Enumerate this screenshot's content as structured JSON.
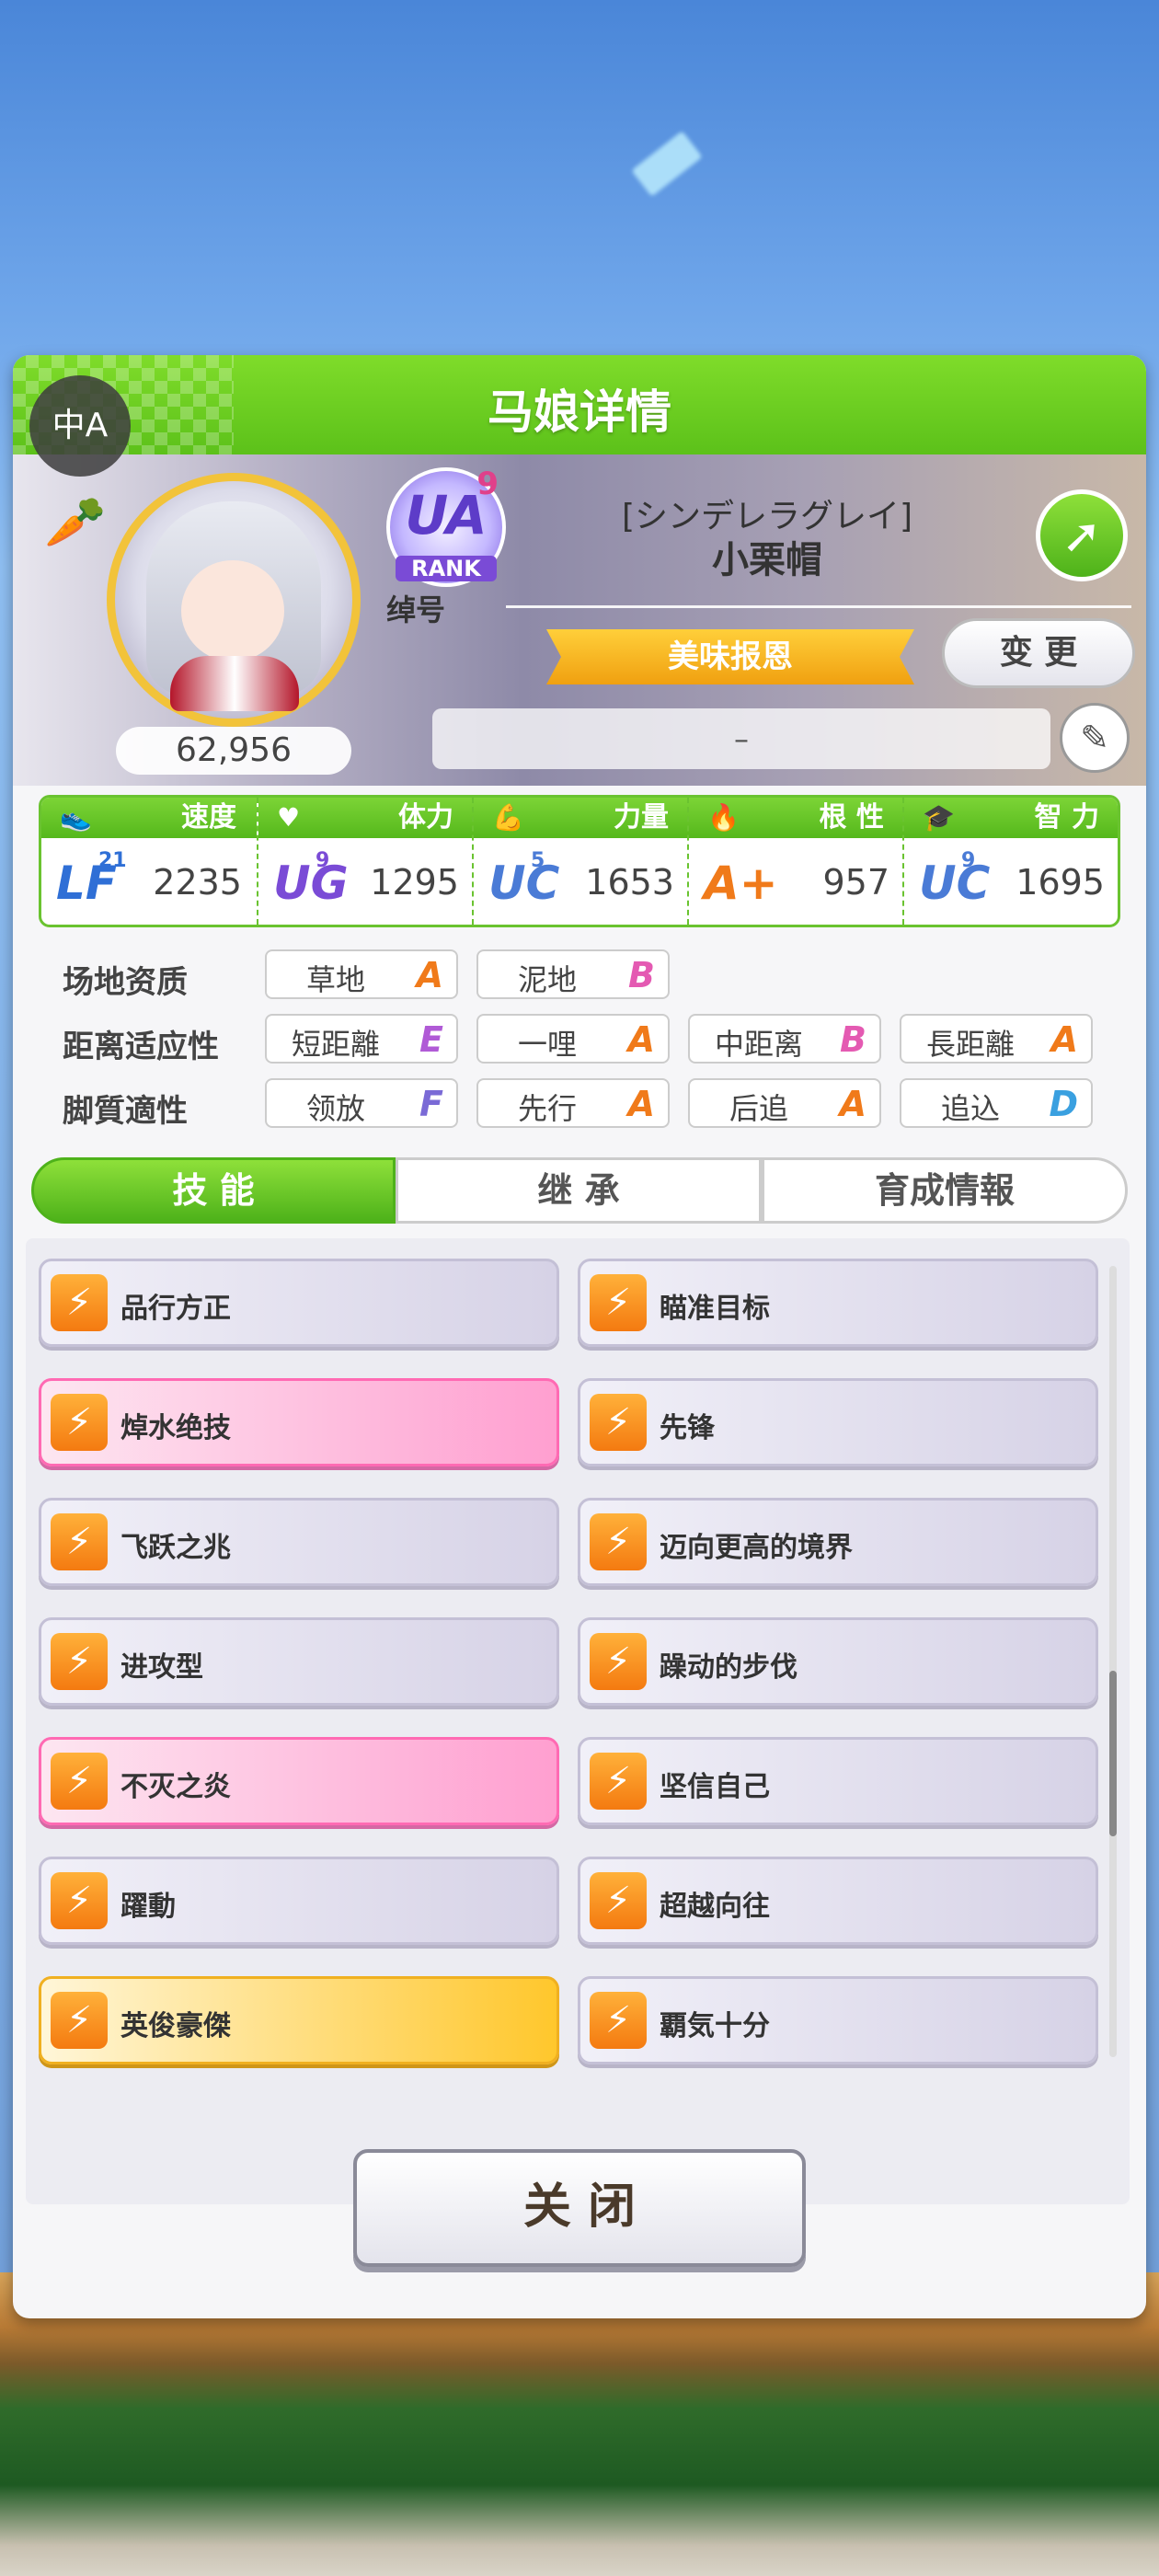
{
  "header": {
    "title": "马娘详情",
    "translate_icon": "中A"
  },
  "profile": {
    "score": "62,956",
    "rank_badge": {
      "letters": "UA",
      "number": "9",
      "label": "RANK"
    },
    "title_caption": "绰号",
    "epithet": "[シンデレラグレイ]",
    "name": "小栗帽",
    "title_ribbon": "美味报恩",
    "change_label": "变 更",
    "comment": "–"
  },
  "stats": [
    {
      "label": "速度",
      "icon": "shoe-icon",
      "grade": "LF",
      "grade_sub": "21",
      "value": "2235",
      "color": "#2f6fd6"
    },
    {
      "label": "体力",
      "icon": "heart-icon",
      "grade": "UG",
      "grade_sub": "9",
      "value": "1295",
      "color": "#7a4bd6"
    },
    {
      "label": "力量",
      "icon": "muscle-icon",
      "grade": "UC",
      "grade_sub": "5",
      "value": "1653",
      "color": "#4a7bd6"
    },
    {
      "label": "根 性",
      "icon": "flame-icon",
      "grade": "A+",
      "grade_sub": "",
      "value": "957",
      "color": "#f07a1a"
    },
    {
      "label": "智 力",
      "icon": "mortarboard-icon",
      "grade": "UC",
      "grade_sub": "9",
      "value": "1695",
      "color": "#4a7bd6"
    }
  ],
  "aptitudes": {
    "field": {
      "label": "场地资质",
      "items": [
        {
          "name": "草地",
          "grade": "A"
        },
        {
          "name": "泥地",
          "grade": "B"
        }
      ]
    },
    "distance": {
      "label": "距离适应性",
      "items": [
        {
          "name": "短距離",
          "grade": "E"
        },
        {
          "name": "一哩",
          "grade": "A"
        },
        {
          "name": "中距离",
          "grade": "B"
        },
        {
          "name": "長距離",
          "grade": "A"
        }
      ]
    },
    "style": {
      "label": "脚質適性",
      "items": [
        {
          "name": "领放",
          "grade": "F"
        },
        {
          "name": "先行",
          "grade": "A"
        },
        {
          "name": "后追",
          "grade": "A"
        },
        {
          "name": "追込",
          "grade": "D"
        }
      ]
    }
  },
  "grade_colors": {
    "A": "#f07a1a",
    "B": "#e45ab2",
    "E": "#b05ad6",
    "F": "#7a6ad6",
    "D": "#3aa0e0"
  },
  "tabs": [
    "技 能",
    "继 承",
    "育成情報"
  ],
  "skills": [
    {
      "name": "品行方正",
      "style": "normal"
    },
    {
      "name": "瞄准目标",
      "style": "normal"
    },
    {
      "name": "焯水绝技",
      "style": "pink"
    },
    {
      "name": "先锋",
      "style": "normal"
    },
    {
      "name": "飞跃之兆",
      "style": "normal"
    },
    {
      "name": "迈向更高的境界",
      "style": "normal"
    },
    {
      "name": "进攻型",
      "style": "normal"
    },
    {
      "name": "躁动的步伐",
      "style": "normal"
    },
    {
      "name": "不灭之炎",
      "style": "pink"
    },
    {
      "name": "坚信自己",
      "style": "normal"
    },
    {
      "name": "躍動",
      "style": "normal"
    },
    {
      "name": "超越向往",
      "style": "normal"
    },
    {
      "name": "英俊豪傑",
      "style": "gold"
    },
    {
      "name": "覇気十分",
      "style": "normal"
    }
  ],
  "close_label": "关 闭"
}
